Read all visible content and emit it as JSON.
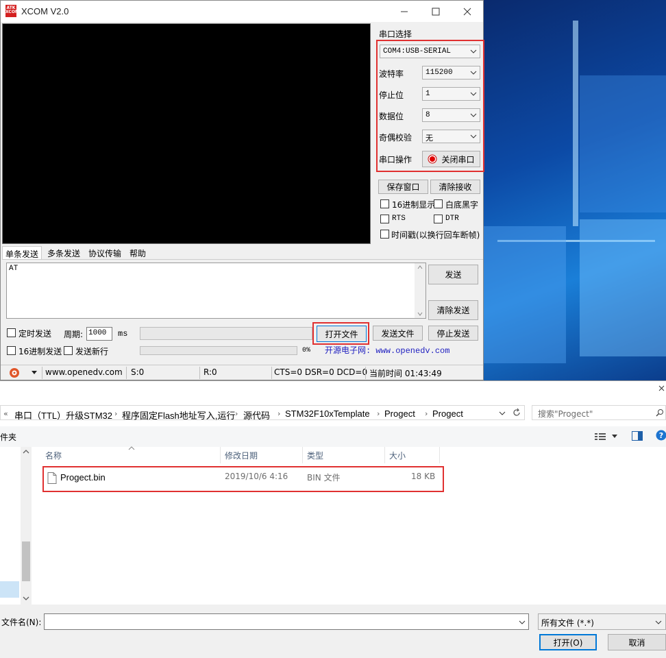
{
  "xcom": {
    "title": "XCOM V2.0",
    "logo_text": "ATK XCOM",
    "serial_section_label": "串口选择",
    "port_value": "COM4:USB-SERIAL",
    "baud_label": "波特率",
    "baud_value": "115200",
    "stopbit_label": "停止位",
    "stopbit_value": "1",
    "databit_label": "数据位",
    "databit_value": "8",
    "parity_label": "奇偶校验",
    "parity_value": "无",
    "serial_op_label": "串口操作",
    "close_port_label": "关闭串口",
    "save_window_label": "保存窗口",
    "clear_receive_label": "清除接收",
    "hex_display_label": "16进制显示",
    "white_bg_label": "白底黑字",
    "rts_label": "RTS",
    "dtr_label": "DTR",
    "timestamp_label": "时间戳(以换行回车断帧)",
    "tabs": [
      "单条发送",
      "多条发送",
      "协议传输",
      "帮助"
    ],
    "send_text": "AT",
    "send_label": "发送",
    "clear_send_label": "清除发送",
    "timed_send_label": "定时发送",
    "period_label": "周期:",
    "period_value": "1000",
    "period_unit": "ms",
    "open_file_label": "打开文件",
    "send_file_label": "发送文件",
    "stop_send_label": "停止发送",
    "hex_send_label": "16进制发送",
    "send_newline_label": "发送新行",
    "progress_text": "0%",
    "progress": 0,
    "site_banner": "开源电子网: www.openedv.com",
    "status": {
      "url": "www.openedv.com",
      "sent": "S:0",
      "received": "R:0",
      "lines": "CTS=0 DSR=0 DCD=0",
      "time": "当前时间 01:43:49"
    }
  },
  "dialog": {
    "breadcrumb": [
      "串口（TTL）升级STM32",
      "程序固定Flash地址写入,运行",
      "源代码",
      "STM32F10xTemplate",
      "Progect",
      "Progect"
    ],
    "search_placeholder": "搜索\"Progect\"",
    "left_fragment": "件夹",
    "columns": [
      "名称",
      "修改日期",
      "类型",
      "大小"
    ],
    "files": [
      {
        "name": "Progect.bin",
        "modified": "2019/10/6 4:16",
        "type": "BIN 文件",
        "size": "18 KB"
      }
    ],
    "filename_label": "文件名(N):",
    "filename_value": "",
    "filetype_value": "所有文件 (*.*)",
    "open_label": "打开(O)",
    "cancel_label": "取消"
  },
  "colors": {
    "highlight": "#e03030",
    "banner_text": "#2020c0",
    "terminal_bg": "#000000"
  }
}
